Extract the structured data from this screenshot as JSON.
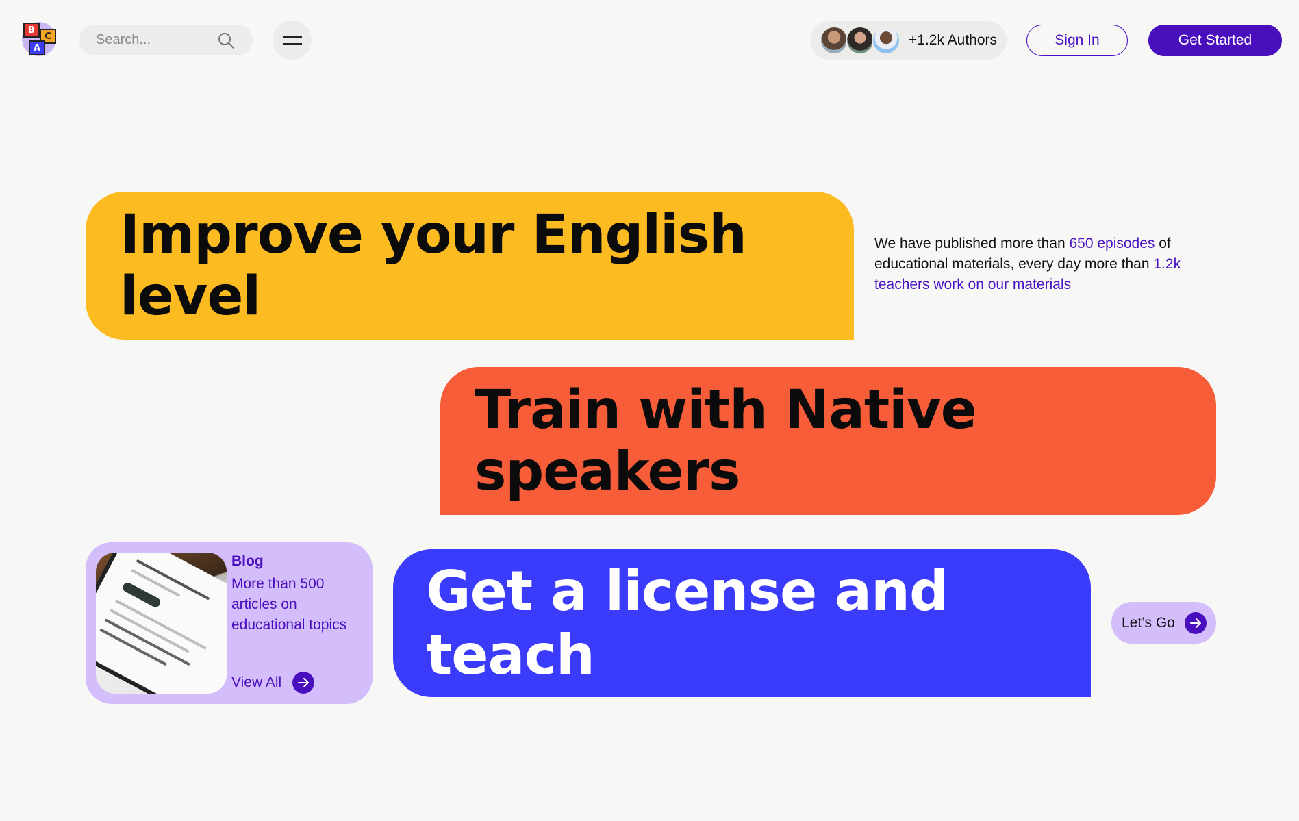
{
  "header": {
    "logo_letters": [
      "B",
      "C",
      "A"
    ],
    "search": {
      "placeholder": "Search..."
    },
    "authors": {
      "label": "+1.2k Authors",
      "avatars": [
        "avatar-1",
        "avatar-2",
        "avatar-3"
      ]
    },
    "sign_in_label": "Sign In",
    "get_started_label": "Get Started"
  },
  "hero": {
    "headline_1": "Improve your English level",
    "headline_2": "Train with Native speakers",
    "headline_3": "Get a license and teach",
    "intro": {
      "part1": "We have published more than ",
      "highlight1": "650 episodes",
      "part2": " of educational materials, every day more than ",
      "highlight2": "1.2k teachers work on our materials"
    }
  },
  "blog": {
    "title": "Blog",
    "description": "More than 500 articles on educational topics",
    "link_label": "View All"
  },
  "cta": {
    "label": "Let’s Go"
  },
  "colors": {
    "background": "#f7f7f5",
    "yellow": "#fdbb22",
    "orange": "#f75d38",
    "blue": "#3b3bfb",
    "purple": "#4a0fbd",
    "lavender": "#d4bdfb"
  }
}
